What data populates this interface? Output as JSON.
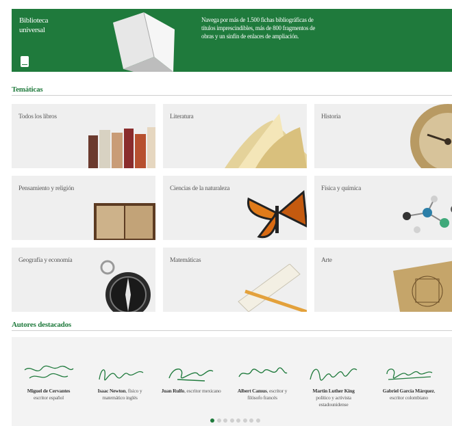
{
  "banner": {
    "title": "Biblioteca universal",
    "text": "Navega por más de 1.500 fichas bibliográficas de títulos imprescindibles, más de 800 fragmentos de obras y un sinfín de enlaces de ampliación."
  },
  "tematicas": {
    "title": "Temáticas",
    "tiles": [
      {
        "label": "Todos los libros"
      },
      {
        "label": "Literatura"
      },
      {
        "label": "Historia"
      },
      {
        "label": "Pensamiento y religión"
      },
      {
        "label": "Ciencias de la naturaleza"
      },
      {
        "label": "Física y química"
      },
      {
        "label": "Geografía y economía"
      },
      {
        "label": "Matemáticas"
      },
      {
        "label": "Arte"
      }
    ]
  },
  "autores": {
    "title": "Autores destacados",
    "items": [
      {
        "name": "Miguel de Cervantes",
        "desc": "escritor español"
      },
      {
        "name": "Isaac Newton",
        "desc": ", físico y matemático inglés"
      },
      {
        "name": "Juan Rulfo",
        "desc": ", escritor mexicano"
      },
      {
        "name": "Albert Camus",
        "desc": ", escritor y filósofo francés"
      },
      {
        "name": "Martin Luther King",
        "desc": "político y activista estadounidense"
      },
      {
        "name": "Gabriel García Márquez",
        "desc": ", escritor colombiano"
      }
    ],
    "pager": {
      "count": 8,
      "active": 1
    }
  },
  "colors": {
    "brand": "#1f7a3c",
    "tile": "#efefef"
  }
}
